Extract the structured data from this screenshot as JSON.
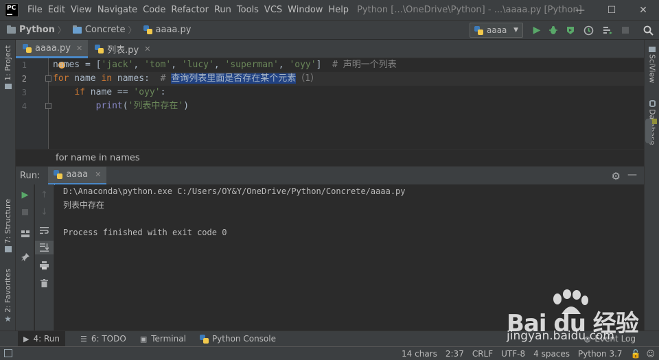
{
  "window": {
    "app_logo": "PC",
    "title": "Python [...\\OneDrive\\Python] - ...\\aaaa.py [Python]",
    "minimize": "—",
    "maximize": "☐",
    "close": "✕"
  },
  "menu": [
    "File",
    "Edit",
    "View",
    "Navigate",
    "Code",
    "Refactor",
    "Run",
    "Tools",
    "VCS",
    "Window",
    "Help"
  ],
  "breadcrumb": [
    "Python",
    "Concrete",
    "aaaa.py"
  ],
  "run_config": {
    "label": "aaaa"
  },
  "left_strip": {
    "project": "1: Project",
    "structure": "7: Structure",
    "favorites": "2: Favorites"
  },
  "right_strip": {
    "sciview": "SciView",
    "database": "Database"
  },
  "editor_tabs": [
    {
      "label": "aaaa.py",
      "active": true
    },
    {
      "label": "列表.py",
      "active": false
    }
  ],
  "editor": {
    "line_numbers": [
      "1",
      "2",
      "3",
      "4"
    ],
    "line1": {
      "var": "names",
      "op": " = [",
      "s1": "'jack'",
      "c1": ", ",
      "s2": "'tom'",
      "c2": ", ",
      "s3": "'lucy'",
      "c3": ", ",
      "s4": "'superman'",
      "c4": ", ",
      "s5": "'oyy'",
      "end": "]  ",
      "comment": "# 声明一个列表"
    },
    "line2": {
      "kw_for": "for",
      "mid": " name ",
      "kw_in": "in",
      "tail": " names:  ",
      "comment_hash": "# ",
      "comment_sel": "查询列表里面是否存在某个元素",
      "comment_rest": "（1）"
    },
    "line3": {
      "indent": "    ",
      "kw_if": "if",
      "mid": " name == ",
      "str": "'oyy'",
      "end": ":"
    },
    "line4": {
      "indent": "        ",
      "fn": "print",
      "open": "(",
      "str": "'列表中存在'",
      "close": ")"
    }
  },
  "code_crumb": "for name in names",
  "run_panel": {
    "label": "Run:",
    "tab": "aaaa",
    "console": [
      "D:\\Anaconda\\python.exe C:/Users/OY&Y/OneDrive/Python/Concrete/aaaa.py",
      "列表中存在",
      "",
      "Process finished with exit code 0"
    ]
  },
  "bottom_tabs": [
    {
      "label": "4: Run",
      "icon": "run-icon",
      "active": true
    },
    {
      "label": "6: TODO",
      "icon": "todo-icon",
      "active": false
    },
    {
      "label": "Terminal",
      "icon": "terminal-icon",
      "active": false
    },
    {
      "label": "Python Console",
      "icon": "python-console-icon",
      "active": false
    },
    {
      "label": "Event Log",
      "icon": "event-log-icon",
      "active": false
    }
  ],
  "status": {
    "chars": "14 chars",
    "position": "2:37",
    "line_sep": "CRLF",
    "encoding": "UTF-8",
    "indent": "4 spaces",
    "interpreter": "Python 3.7"
  },
  "watermark": {
    "brand": "Bai du 经验",
    "url": "jingyan.baidu.com"
  },
  "colors": {
    "accent": "#4a88c7",
    "keyword": "#cc7832",
    "string": "#6a8759",
    "comment": "#808080",
    "selection": "#214283",
    "run_green": "#59a869"
  }
}
